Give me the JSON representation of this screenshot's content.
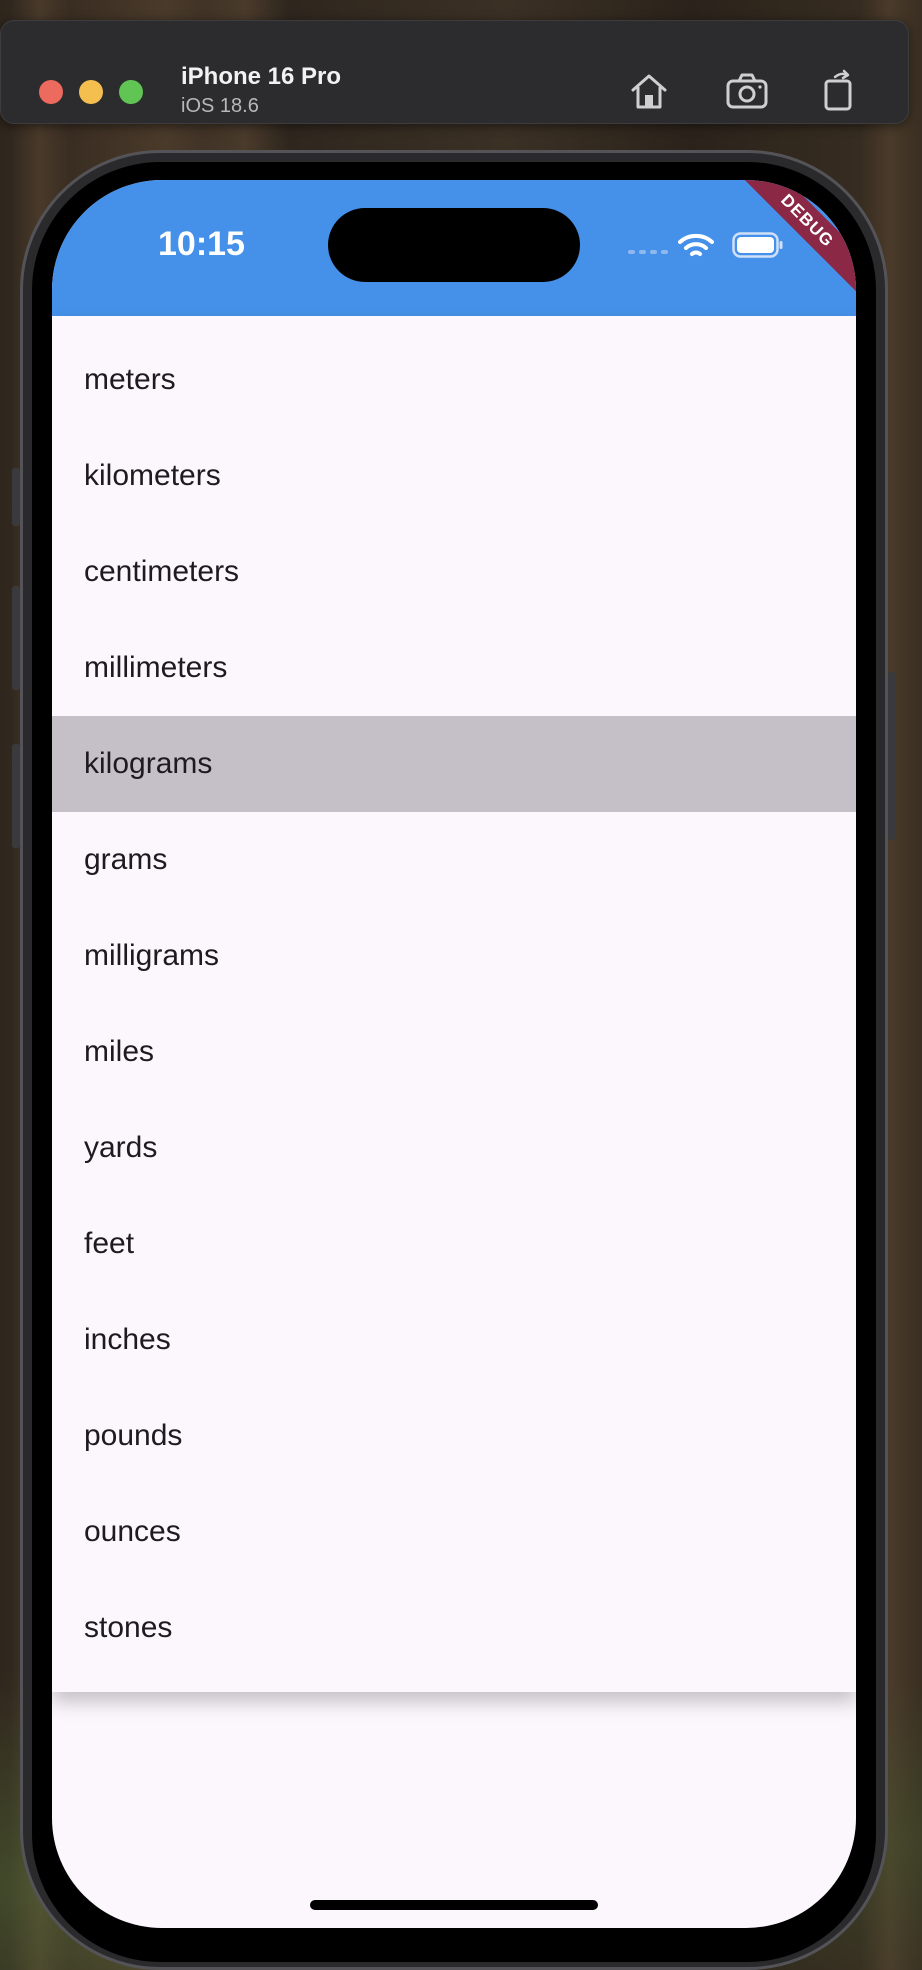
{
  "simulator": {
    "device_name": "iPhone 16 Pro",
    "os_version": "iOS 18.6",
    "toolbar": {
      "home_icon": "home-icon",
      "screenshot_icon": "camera-icon",
      "rotate_icon": "rotate-icon"
    }
  },
  "status_bar": {
    "time": "10:15",
    "debug_banner": "DEBUG",
    "background_color": "#4590e8"
  },
  "menu": {
    "highlighted_index": 4,
    "items": [
      {
        "label": "meters"
      },
      {
        "label": "kilometers"
      },
      {
        "label": "centimeters"
      },
      {
        "label": "millimeters"
      },
      {
        "label": "kilograms"
      },
      {
        "label": "grams"
      },
      {
        "label": "milligrams"
      },
      {
        "label": "miles"
      },
      {
        "label": "yards"
      },
      {
        "label": "feet"
      },
      {
        "label": "inches"
      },
      {
        "label": "pounds"
      },
      {
        "label": "ounces"
      },
      {
        "label": "stones"
      }
    ]
  },
  "colors": {
    "highlight": "#c5c0c8",
    "surface": "#fbf7fd",
    "text": "#1d1b20"
  }
}
